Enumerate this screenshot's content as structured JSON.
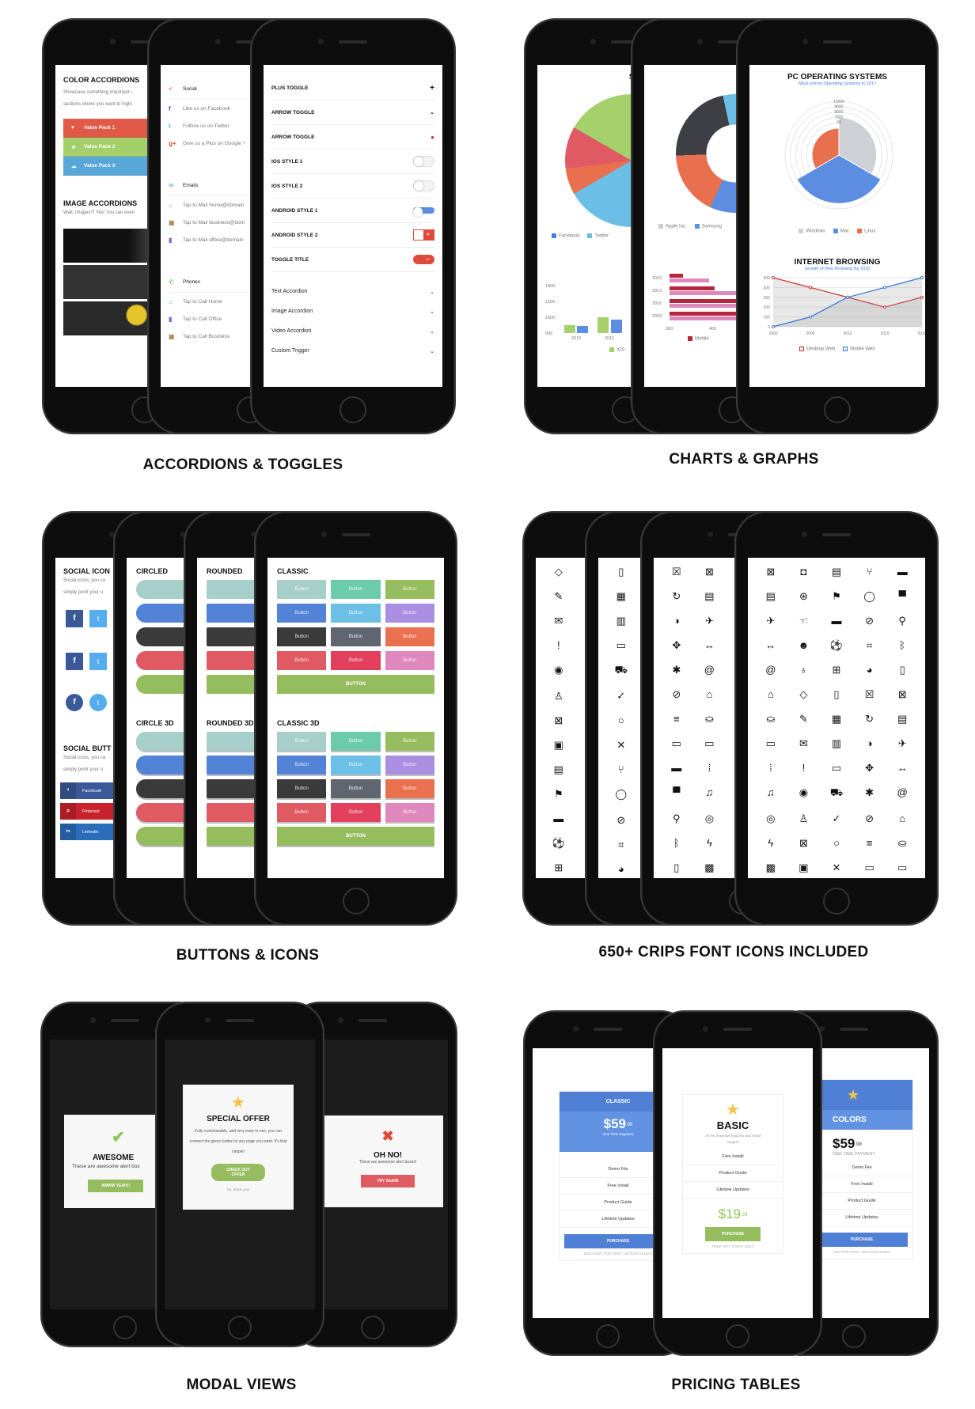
{
  "labels": {
    "accordions": "ACCORDIONS & TOGGLES",
    "charts": "CHARTS & GRAPHS",
    "buttons": "BUTTONS & ICONS",
    "icons": "650+ CRIPS FONT ICONS INCLUDED",
    "modals": "MODAL VIEWS",
    "pricing": "PRICING TABLES"
  },
  "accordions": {
    "color_title": "COLOR ACCORDIONS",
    "color_text1": "Showcase something important i",
    "color_text2": "sections where you want to highl",
    "packs": [
      {
        "label": "Value Pack 1",
        "icon": "heart-icon",
        "color": "#e05a47"
      },
      {
        "label": "Value Pack 2",
        "icon": "star-icon",
        "color": "#a5cf6a"
      },
      {
        "label": "Value Pack 3",
        "icon": "cloud-icon",
        "color": "#58a7d9"
      }
    ],
    "image_title": "IMAGE ACCORDIONS",
    "image_text": "Wait, images?! Yes! You can even",
    "contacts": {
      "social": "Social",
      "social_items": [
        "Like us on Facebook",
        "Folllow us on Twitter",
        "Give us a Plus on Google +"
      ],
      "emails": "Emails",
      "email_items": [
        "Tap to Mail home@domain",
        "Tap to Mail business@dom",
        "Tap to Mail office@domain"
      ],
      "phones": "Phones",
      "phone_items": [
        "Tap to Call Home",
        "Tap to Call Office",
        "Tap to Call Business"
      ]
    },
    "toggles": [
      {
        "label": "PLUS TOGGLE",
        "control": "plus"
      },
      {
        "label": "ARROW TOGGLE",
        "control": "chevron"
      },
      {
        "label": "ARROW TOGGLE",
        "control": "dot"
      },
      {
        "label": "IOS STYLE 1",
        "control": "ios"
      },
      {
        "label": "IOS STYLE 2",
        "control": "ios"
      },
      {
        "label": "ANDROID STYLE 1",
        "control": "android"
      },
      {
        "label": "ANDROID STYLE 2",
        "control": "android2"
      },
      {
        "label": "TOGGLE TITLE",
        "control": "pill"
      }
    ],
    "accordion_items": [
      "Text Accordion",
      "Image Accordion",
      "Video Accordion",
      "Custom Trigger"
    ]
  },
  "charts": {
    "social": {
      "title": "SOCIAL NI",
      "subtitle": "Social Networks by",
      "legend": [
        "Facebook",
        "Twitter"
      ]
    },
    "mobile": {
      "title": "MOBIL",
      "subtitle": "Growth of Mob",
      "yticks": [
        "1400",
        "1200",
        "1000",
        "800"
      ],
      "xticks": [
        "2010",
        "2015"
      ],
      "legend": [
        "iOS"
      ]
    },
    "devices": {
      "title": "MOBILE I",
      "subtitle": "Mobile Devices",
      "legend": [
        "Apple Inc.",
        "Samsung"
      ]
    },
    "mobileweb": {
      "title": "MOBILE W",
      "subtitle": "Growth of Mobile W",
      "yticks": [
        "2010",
        "2013",
        "2016",
        "2020"
      ],
      "xticks": [
        "300",
        "400"
      ],
      "legend": [
        "Mobile"
      ]
    },
    "pcos": {
      "title": "PC OPERATING SYSTEMS",
      "subtitle": "Most comon Operating Systems in 2017",
      "rticks": [
        "10000",
        "9000",
        "8000",
        "7000",
        "60"
      ]
    },
    "browsing": {
      "title": "INTERNET BROWSING",
      "subtitle": "Growth of Web Browsing By 2020"
    }
  },
  "chart_data": [
    {
      "type": "pie",
      "title": "PC OPERATING SYSTEMS",
      "subtitle": "Most comon Operating Systems in 2017",
      "categories": [
        "Windows",
        "Mac",
        "Linux"
      ],
      "values": [
        7000,
        9000,
        5000
      ],
      "colors": [
        "#cdd0d5",
        "#5b8de0",
        "#e9704f"
      ],
      "rlim": [
        0,
        10000
      ],
      "legend": "bottom"
    },
    {
      "type": "line",
      "title": "INTERNET BROWSING",
      "subtitle": "Growth of Web Browsing By 2020",
      "x": [
        "2000",
        "2005",
        "2010",
        "2015",
        "2010"
      ],
      "series": [
        {
          "name": "Desktop Web",
          "values": [
            500,
            400,
            300,
            200,
            300
          ],
          "color": "#d0363a"
        },
        {
          "name": "Mobile Web",
          "values": [
            0,
            100,
            300,
            400,
            500
          ],
          "color": "#3a78d8"
        }
      ],
      "ylim": [
        0,
        500
      ],
      "yticks": [
        "0",
        "100",
        "200",
        "300",
        "400",
        "500"
      ],
      "grid": true,
      "legend": "bottom"
    }
  ],
  "buttons": {
    "social_title": "SOCIAL ICON",
    "social_text1": "Social icons, you ca",
    "social_text2": "simply point your u",
    "social_btn_title": "SOCIAL BUTT",
    "social_btns": [
      {
        "label": "Facebook",
        "color": "#3b5998"
      },
      {
        "label": "Pinterest",
        "color": "#c8232c"
      },
      {
        "label": "Linkedin",
        "color": "#2a6ebb"
      }
    ],
    "circled": "CIRCLED",
    "circle3d": "CIRCLE 3D",
    "rounded": "ROUNDED",
    "rounded3d": "ROUNDED 3D",
    "classic": "CLASSIC",
    "classic3d": "CLASSIC 3D",
    "btn": "Button",
    "wide": "BUTTON",
    "colors": [
      "#a6cfca",
      "#6ccbaa",
      "#95bd5e",
      "#5283d6",
      "#6cbfe6",
      "#a98ee2",
      "#3a3a3a",
      "#5f6670",
      "#ea7150",
      "#df5a62",
      "#e3405e",
      "#df88bd"
    ],
    "green": "#95bd5e"
  },
  "icons": [
    "diamond",
    "edit",
    "envelope-open",
    "exclamation",
    "eye",
    "walk",
    "file-x",
    "image",
    "file",
    "flag",
    "folder",
    "soccer",
    "gift",
    "mobile",
    "calculator",
    "calendar",
    "archive",
    "cart",
    "check-circle",
    "circle",
    "close",
    "fork",
    "chat",
    "compass",
    "crop",
    "palette",
    "close-box",
    "refresh",
    "halfmoon",
    "move",
    "asterisk",
    "ban",
    "menu",
    "battery",
    "battery-full",
    "desktop",
    "bike",
    "bluetooth",
    "bookmark",
    "close-square",
    "id",
    "plane",
    "arrows",
    "at",
    "bank",
    "bath",
    "battery-half",
    "dots",
    "bell",
    "binoculars",
    "bolt",
    "qr",
    "camera",
    "support",
    "hand",
    "user-badge",
    "bulb"
  ],
  "modals": {
    "awesome": {
      "title": "AWESOME",
      "text": "These are awesome alert box",
      "button": "AWWW YEAH!!"
    },
    "offer": {
      "title": "SPECIAL OFFER",
      "text": "Fully customizable, and very easy to use, you can connect the green button to any page you want. It's that simple!",
      "button": "CHECK OUT OFFER",
      "link": "No, thank you!"
    },
    "ohno": {
      "title": "OH NO!",
      "text": "These are awesome alert boxes!",
      "button": "TRY AGAIN"
    }
  },
  "pricing": {
    "classic": {
      "name": "CLASSIC",
      "price": "$59",
      "cents": ".99",
      "period": "One Time Payment",
      "features": [
        "Demo File",
        "Free Install",
        "Product Guide",
        "Lifetime Updates"
      ],
      "button": "PURCHASE",
      "note": "DISCOUNT FOR FIRST 100 PURCHASES"
    },
    "basic": {
      "name": "BASIC",
      "desc": "All the essential features and email support",
      "features": [
        "Free Install",
        "Product Guide",
        "Lifetime Updates"
      ],
      "price": "$19",
      "cents": ".99",
      "button": "PURCHASE",
      "note": "FREE GIFT TODAY ONLY"
    },
    "colors": {
      "name": "COLORS",
      "price": "$59",
      "cents": ".99",
      "period": "ONE TIME PAYMENT",
      "features": [
        "Demo File",
        "Free Install",
        "Product Guide",
        "Lifetime Updates"
      ],
      "button": "PURCHASE",
      "note": "UNT FOR FIRST 100 PURCHASES"
    }
  },
  "theme": {
    "blue": "#5b8de0",
    "green": "#95bd5e",
    "red": "#df5a62",
    "star": "#f5c244"
  }
}
